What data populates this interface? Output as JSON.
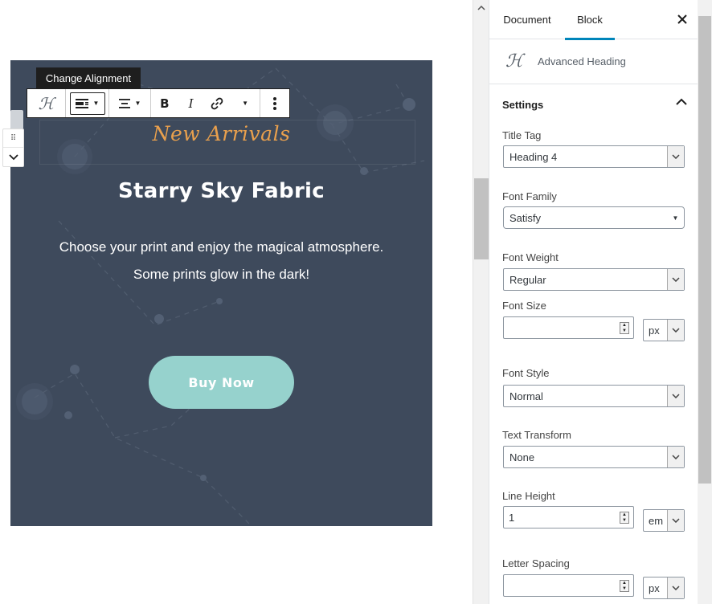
{
  "toolbar": {
    "tooltip": "Change Alignment"
  },
  "cover": {
    "subtitle": "New Arrivals",
    "title": "Starry Sky Fabric",
    "paragraph_line1": "Choose your print and enjoy the magical atmosphere.",
    "paragraph_line2": "Some prints glow in the dark!",
    "button_label": "Buy Now",
    "background_color": "#3e4a5c",
    "subtitle_color": "#e9a04d",
    "button_color": "#96d2cd"
  },
  "sidebar": {
    "tabs": [
      {
        "label": "Document",
        "active": false
      },
      {
        "label": "Block",
        "active": true
      }
    ],
    "close_icon": "close-icon",
    "block_name": "Advanced Heading",
    "panel_title": "Settings",
    "fields": {
      "title_tag": {
        "label": "Title Tag",
        "value": "Heading 4"
      },
      "font_family": {
        "label": "Font Family",
        "value": "Satisfy"
      },
      "font_weight": {
        "label": "Font Weight",
        "value": "Regular"
      },
      "font_size": {
        "label": "Font Size",
        "value": "",
        "unit": "px"
      },
      "font_style": {
        "label": "Font Style",
        "value": "Normal"
      },
      "text_transform": {
        "label": "Text Transform",
        "value": "None"
      },
      "line_height": {
        "label": "Line Height",
        "value": "1",
        "unit": "em"
      },
      "letter_spacing": {
        "label": "Letter Spacing",
        "value": "",
        "unit": "px"
      }
    }
  },
  "colors": {
    "accent": "#0085ba"
  }
}
